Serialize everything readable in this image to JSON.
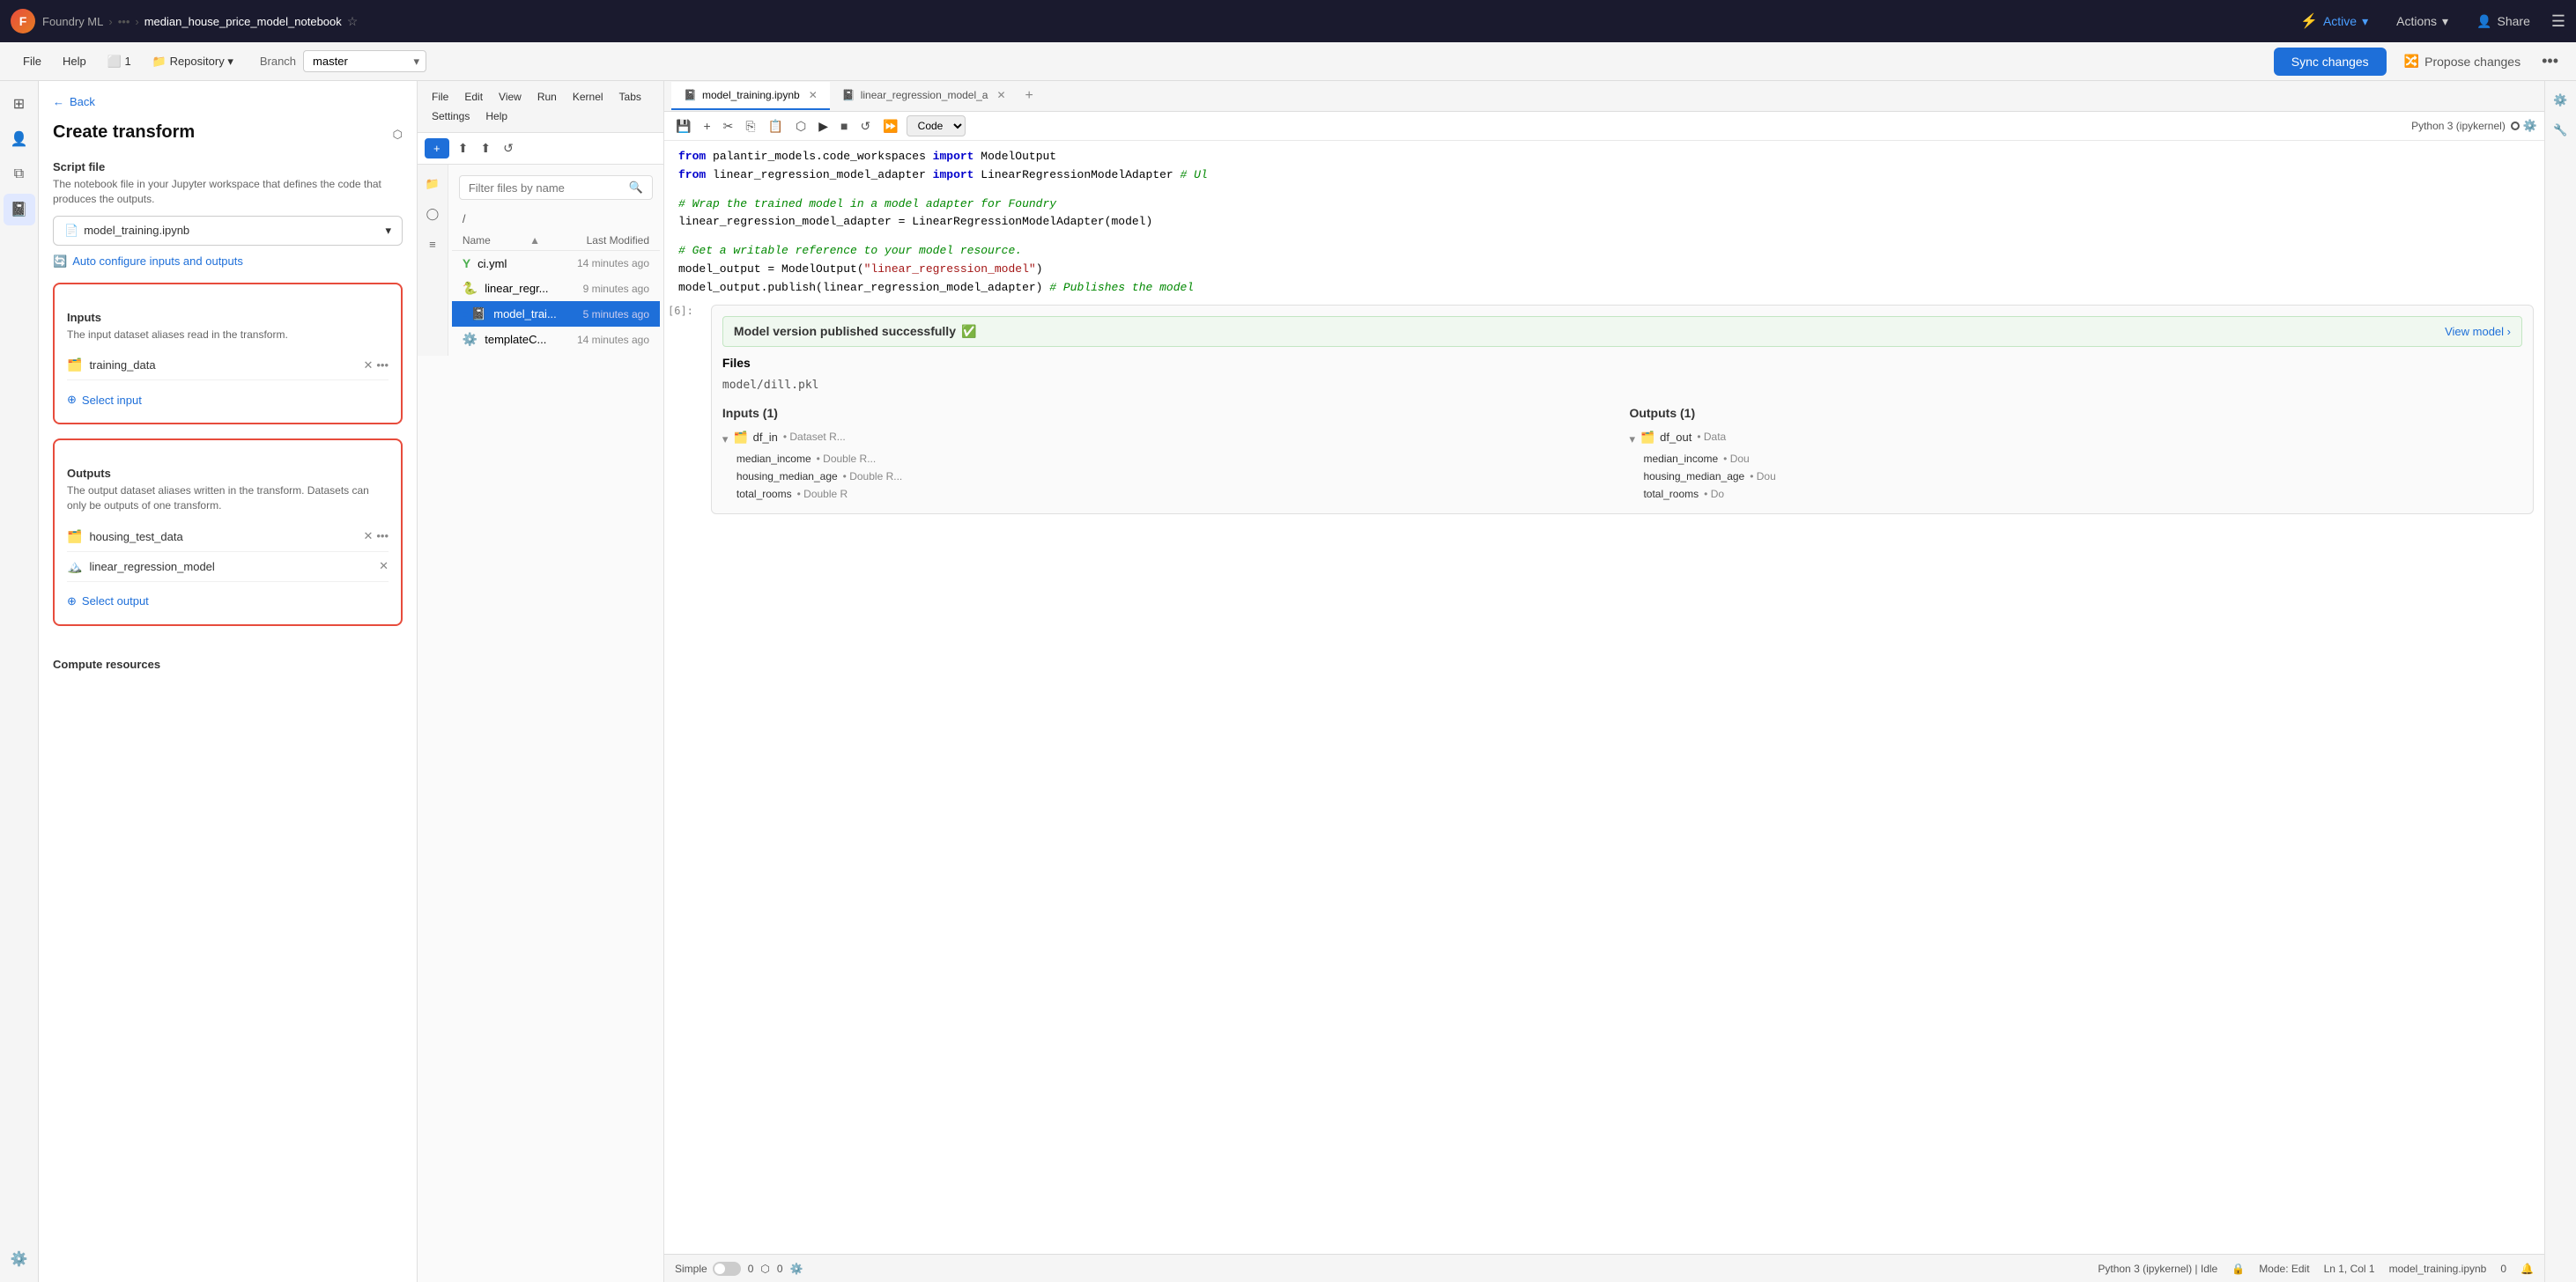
{
  "topbar": {
    "logo": "F",
    "breadcrumb": [
      "Foundry ML",
      "median_house_price_model_notebook"
    ],
    "active_label": "Active",
    "actions_label": "Actions",
    "share_label": "Share"
  },
  "secondbar": {
    "file_label": "File",
    "help_label": "Help",
    "repo_count": "1",
    "repository_label": "Repository",
    "branch_label": "Branch",
    "branch_value": "master",
    "sync_label": "Sync changes",
    "propose_label": "Propose changes"
  },
  "left_panel": {
    "back_label": "Back",
    "title": "Create transform",
    "script_section": "Script file",
    "script_desc": "The notebook file in your Jupyter workspace that defines the code that produces the outputs.",
    "script_file": "model_training.ipynb",
    "auto_configure": "Auto configure inputs and outputs",
    "inputs_title": "Inputs",
    "inputs_desc": "The input dataset aliases read in the transform.",
    "input_items": [
      {
        "name": "training_data",
        "icon": "🗂️"
      }
    ],
    "select_input_label": "Select input",
    "outputs_title": "Outputs",
    "outputs_desc": "The output dataset aliases written in the transform. Datasets can only be outputs of one transform.",
    "output_items": [
      {
        "name": "housing_test_data",
        "icon": "🗂️"
      },
      {
        "name": "linear_regression_model",
        "icon": "🏔️"
      }
    ],
    "select_output_label": "Select output",
    "compute_title": "Compute resources"
  },
  "file_browser": {
    "menu_items": [
      "File",
      "Edit",
      "View",
      "Run",
      "Kernel",
      "Tabs",
      "Settings",
      "Help"
    ],
    "new_btn": "+",
    "search_placeholder": "Filter files by name",
    "path": "/",
    "name_col": "Name",
    "modified_col": "Last Modified",
    "files": [
      {
        "icon": "Y",
        "name": "ci.yml",
        "color": "#4caf50",
        "modified": "14 minutes ago"
      },
      {
        "icon": "🐍",
        "name": "linear_regr...",
        "color": "#3776ab",
        "modified": "9 minutes ago"
      },
      {
        "icon": "📓",
        "name": "model_trai...",
        "color": "#ff7043",
        "modified": "5 minutes ago",
        "active": true
      },
      {
        "icon": "⚙️",
        "name": "templateC...",
        "color": "#ff9800",
        "modified": "14 minutes ago"
      }
    ]
  },
  "code_panel": {
    "tabs": [
      {
        "label": "model_training.ipynb",
        "icon": "📓",
        "active": true
      },
      {
        "label": "linear_regression_model_a",
        "icon": "📓",
        "active": false
      }
    ],
    "toolbar": {
      "code_mode": "Code",
      "kernel": "Python 3 (ipykernel)"
    },
    "code_lines": [
      {
        "text": "from palantir_models.code_workspaces import ModelOutput",
        "parts": [
          {
            "type": "kw",
            "t": "from"
          },
          {
            "type": "plain",
            "t": " palantir_models.code_workspaces "
          },
          {
            "type": "kw",
            "t": "import"
          },
          {
            "type": "plain",
            "t": " ModelOutput"
          }
        ]
      },
      {
        "text": "from linear_regression_model_adapter import LinearRegressionModelAdapter # Ul",
        "parts": [
          {
            "type": "kw",
            "t": "from"
          },
          {
            "type": "plain",
            "t": " linear_regression_model_adapter "
          },
          {
            "type": "kw",
            "t": "import"
          },
          {
            "type": "plain",
            "t": " LinearRegressionModelAdapter "
          },
          {
            "type": "cm",
            "t": "# Ul"
          }
        ]
      }
    ],
    "code_block2": [
      {
        "text": "# Wrap the trained model in a model adapter for Foundry",
        "type": "comment"
      },
      {
        "text": "linear_regression_model_adapter = LinearRegressionModelAdapter(model)"
      },
      {
        "text": ""
      },
      {
        "text": "# Get a writable reference to your model resource.",
        "type": "comment"
      },
      {
        "text": "model_output = ModelOutput(\"linear_regression_model\")"
      },
      {
        "text": "model_output.publish(linear_regression_model_adapter) # Publishes the model"
      }
    ],
    "cell_output": {
      "number": "[6]:",
      "success_text": "Model version published successfully",
      "view_model_label": "View model ›",
      "files_label": "Files",
      "file_path": "model/dill.pkl",
      "inputs_title": "Inputs (1)",
      "outputs_title": "Outputs (1)",
      "inputs": {
        "name": "df_in",
        "type": "Dataset",
        "access": "R...",
        "fields": [
          {
            "name": "median_income",
            "type": "Double",
            "access": "R..."
          },
          {
            "name": "housing_median_age",
            "type": "Double",
            "access": "R..."
          },
          {
            "name": "total_rooms",
            "type": "Double",
            "access": "R"
          }
        ]
      },
      "outputs": {
        "name": "df_out",
        "type": "Data",
        "fields": [
          {
            "name": "median_income",
            "type": "Dou"
          },
          {
            "name": "housing_median_age",
            "type": "Dou"
          },
          {
            "name": "total_rooms",
            "type": "Do"
          }
        ]
      }
    }
  },
  "status_bar": {
    "simple_label": "Simple",
    "zero1": "0",
    "zero2": "0",
    "python_label": "Python 3 (ipykernel) | Idle",
    "mode_label": "Mode: Edit",
    "ln_label": "Ln 1, Col 1",
    "file_label": "model_training.ipynb",
    "zero3": "0"
  }
}
